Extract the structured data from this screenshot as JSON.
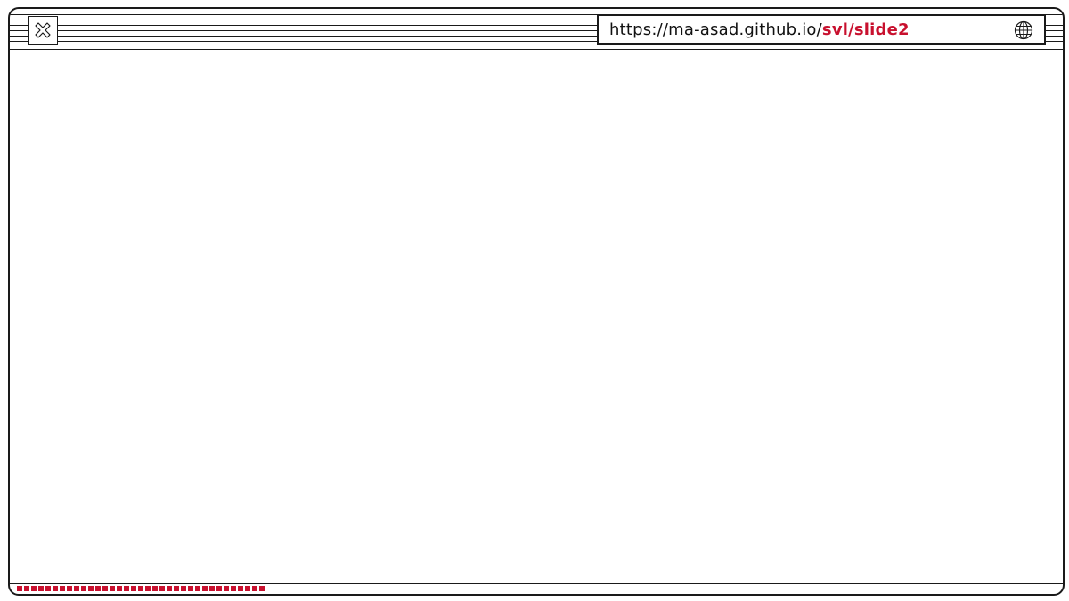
{
  "browser": {
    "close_icon": "close-x-icon",
    "address": {
      "host": "https://ma-asad.github.io/",
      "path": "svl/slide2"
    },
    "globe_icon": "globe-icon"
  },
  "colors": {
    "accent": "#c8102e",
    "stroke": "#1a1a1a",
    "background": "#ffffff"
  },
  "progress": {
    "fraction": 0.24
  }
}
